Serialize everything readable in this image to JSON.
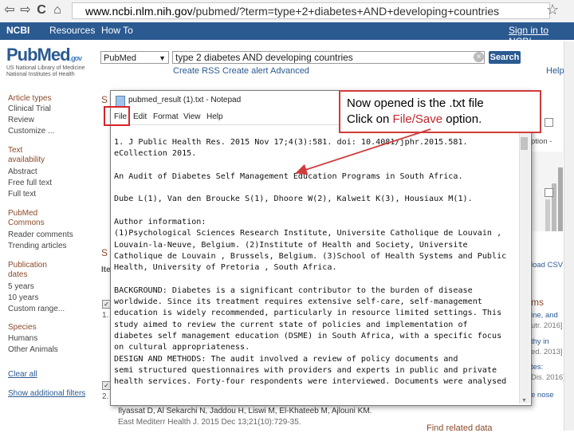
{
  "browser": {
    "url_host": "www.ncbi.nlm.nih.gov",
    "url_path": "/pubmed/?term=type+2+diabetes+AND+developing+countries",
    "back_glyph": "⇦",
    "forward_glyph": "⇨",
    "reload_glyph": "C",
    "home_glyph": "⌂",
    "star_glyph": "☆"
  },
  "ncbi_bar": {
    "brand": "NCBI",
    "resources": "Resources",
    "howto": "How To",
    "signin": "Sign in to NCBI"
  },
  "pubmed": {
    "logo_text": "PubMed",
    "logo_suffix": ".gov",
    "logo_sub1": "US National Library of Medicine",
    "logo_sub2": "National Institutes of Health",
    "db_select": "PubMed",
    "search_value": "type 2 diabetes AND developing countries",
    "search_button": "Search",
    "create_rss": "Create RSS",
    "create_alert": "Create alert",
    "advanced": "Advanced",
    "help": "Help"
  },
  "sidebar": {
    "article_types": "Article types",
    "at_items": [
      "Clinical Trial",
      "Review",
      "Customize ..."
    ],
    "text_avail": "Text",
    "text_avail2": "availability",
    "text_items": [
      "Abstract",
      "Free full text",
      "Full text"
    ],
    "pmc": "PubMed",
    "pmc2": "Commons",
    "pmc_items": [
      "Reader comments",
      "Trending articles"
    ],
    "pubdates": "Publication",
    "pubdates2": "dates",
    "date_items": [
      "5 years",
      "10 years",
      "Custom range..."
    ],
    "species": "Species",
    "species_items": [
      "Humans",
      "Other Animals"
    ],
    "clear_all": "Clear all",
    "show_filters": "Show additional filters"
  },
  "background": {
    "below_text1": "Ilyassat D, Al Sekarchi N, Jaddou H, Liswi M, El-Khateeb M, Ajlouni KM.",
    "below_text2": "East Mediterr Health J. 2015 Dec 13;21(10):729-35.",
    "right_frag1": "ption -",
    "right_frag2": "load CSV",
    "right_frag3": "ms",
    "right_frag4": "ine, and",
    "right_frag5": "utr. 2016]",
    "right_frag6": "thy in",
    "right_frag7": "ed. 2013]",
    "right_frag8": "tes:",
    "right_frag9": "Dis. 2016]",
    "right_frag10": "e nose",
    "find_related": "Find related data",
    "mid_frag1": "S",
    "mid_frag2": "Ite",
    "mid_num1": "1.",
    "mid_num2": "2."
  },
  "notepad": {
    "title": "pubmed_result (1).txt - Notepad",
    "menu": [
      "File",
      "Edit",
      "Format",
      "View",
      "Help"
    ],
    "lines": [
      "1. J Public Health Res. 2015 Nov 17;4(3):581. doi: 10.4081/jphr.2015.581.",
      "eCollection 2015.",
      "",
      "An Audit of Diabetes Self Management Education Programs in South Africa.",
      "",
      "Dube L(1), Van den Broucke S(1), Dhoore W(2), Kalweit K(3), Housiaux M(1).",
      "",
      "Author information:",
      "(1)Psychological Sciences Research Institute, Universite Catholique de Louvain ,",
      "Louvain-la-Neuve, Belgium. (2)Institute of Health and Society, Universite",
      "Catholique de Louvain , Brussels, Belgium. (3)School of Health Systems and Public",
      "Health, University of Pretoria , South Africa.",
      "",
      "BACKGROUND: Diabetes is a significant contributor to the burden of disease",
      "worldwide. Since its treatment requires extensive self-care, self-management",
      "education is widely recommended, particularly in resource limited settings. This",
      "study aimed to review the current state of policies and implementation of",
      "diabetes self management education (DSME) in South Africa, with a specific focus",
      "on cultural appropriateness.",
      "DESIGN AND METHODS: The audit involved a review of policy documents and",
      "semi structured questionnaires with providers and experts in public and private",
      "health services. Forty-four respondents were interviewed. Documents were analysed"
    ]
  },
  "callout": {
    "line1": "Now opened is the .txt file",
    "line2_pre": "Click on ",
    "line2_hl": "File/Save",
    "line2_post": " option."
  },
  "colors": {
    "ncbi_blue": "#2b5a91",
    "callout_red": "#d13b3b",
    "highlight_red": "#c0282f"
  }
}
